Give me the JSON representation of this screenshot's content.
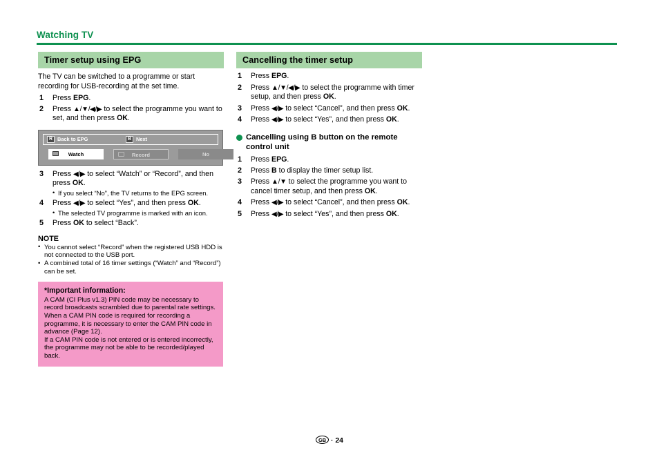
{
  "running_head": {
    "title": "Watching TV",
    "accent_color": "#0E9150"
  },
  "footer": {
    "region_code": "GB",
    "separator": "·",
    "page_number": "24"
  },
  "left_column": {
    "section_heading": "Timer setup using EPG",
    "intro": "The TV can be switched to a programme or start recording for USB-recording at the set time.",
    "steps": [
      {
        "num": "1",
        "text_before": "Press ",
        "bold": "EPG",
        "text_after": "."
      },
      {
        "num": "2",
        "text_before": "Press ",
        "arrows": "▲/▼/◀/▶",
        "text_mid": " to select the programme you want to set, and then press ",
        "bold": "OK",
        "text_after": "."
      }
    ],
    "epg_mock": {
      "key_r_label": "R",
      "key_r_text": "Back to EPG",
      "key_b_label": "B",
      "key_b_text": "Next",
      "button_watch": "Watch",
      "button_record": "Record",
      "button_no": "No"
    },
    "steps2": [
      {
        "num": "3",
        "text_before": "Press ",
        "arrows": "◀/▶",
        "text_mid": " to select “Watch” or “Record”, and then press ",
        "bold": "OK",
        "text_after": ".",
        "subs": [
          "If you select “No”, the TV returns to the EPG screen."
        ]
      },
      {
        "num": "4",
        "text_before": "Press ",
        "arrows": "◀/▶",
        "text_mid": " to select “Yes”, and then press ",
        "bold": "OK",
        "text_after": ".",
        "subs": [
          "The selected TV programme is marked with an icon."
        ]
      },
      {
        "num": "5",
        "text_before": "Press ",
        "bold": "OK",
        "text_after": " to select “Back”."
      }
    ],
    "note_title": "NOTE",
    "notes": [
      "You cannot select “Record” when the registered USB HDD is not connected to the USB port.",
      "A combined total of 16 timer settings (“Watch” and “Record”) can be set."
    ],
    "important": {
      "title": "*Important information:",
      "paragraphs": [
        "A CAM (CI Plus v1.3) PIN code may be necessary to record broadcasts scrambled due to parental rate settings.",
        "When a CAM PIN code is required for recording a programme, it is necessary to enter the CAM PIN code in advance (Page 12).",
        "If a CAM PIN code is not entered or is entered incorrectly, the programme may not be able to be recorded/played back."
      ],
      "background_color": "#F49AC8"
    }
  },
  "right_column": {
    "section_heading": "Cancelling the timer setup",
    "steps": [
      {
        "num": "1",
        "text_before": "Press ",
        "bold": "EPG",
        "text_after": "."
      },
      {
        "num": "2",
        "text_before": "Press ",
        "arrows": "▲/▼/◀/▶",
        "text_mid": " to select the programme with timer setup, and then press ",
        "bold": "OK",
        "text_after": "."
      },
      {
        "num": "3",
        "text_before": "Press ",
        "arrows": "◀/▶",
        "text_mid": " to select “Cancel”, and then press ",
        "bold": "OK",
        "text_after": "."
      },
      {
        "num": "4",
        "text_before": "Press ",
        "arrows": "◀/▶",
        "text_mid": " to select “Yes”, and then press ",
        "bold": "OK",
        "text_after": "."
      }
    ],
    "sub_heading": "Cancelling using B button on the remote control unit",
    "steps2": [
      {
        "num": "1",
        "text_before": "Press ",
        "bold": "EPG",
        "text_after": "."
      },
      {
        "num": "2",
        "text_before": "Press ",
        "bold": "B",
        "text_after": " to display the timer setup list."
      },
      {
        "num": "3",
        "text_before": "Press ",
        "arrows": "▲/▼",
        "text_mid": " to select the programme you want to cancel timer setup, and then press ",
        "bold": "OK",
        "text_after": "."
      },
      {
        "num": "4",
        "text_before": "Press ",
        "arrows": "◀/▶",
        "text_mid": " to select “Cancel”, and then press ",
        "bold": "OK",
        "text_after": "."
      },
      {
        "num": "5",
        "text_before": "Press ",
        "arrows": "◀/▶",
        "text_mid": " to select “Yes”, and then press ",
        "bold": "OK",
        "text_after": "."
      }
    ]
  }
}
